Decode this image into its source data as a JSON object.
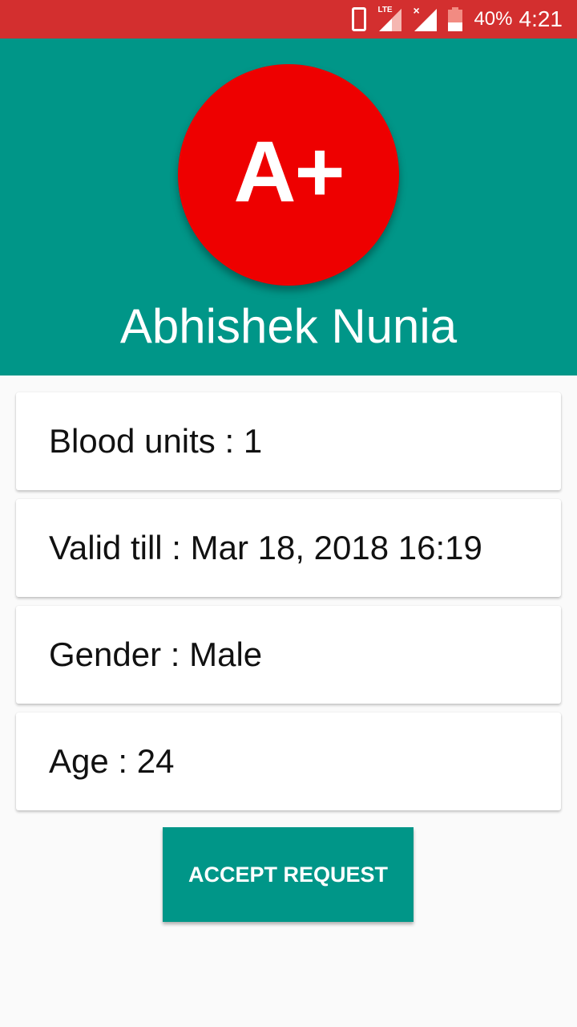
{
  "status_bar": {
    "battery_percent": "40%",
    "time": "4:21",
    "network_label": "LTE",
    "icons": [
      "phone-icon",
      "signal-lte-icon",
      "signal-no-service-icon",
      "battery-icon"
    ]
  },
  "header": {
    "blood_group": "A+",
    "donor_name": "Abhishek Nunia",
    "background_color": "#009688",
    "badge_color": "#ee0000"
  },
  "details": {
    "units": "Blood units : 1",
    "valid_till": "Valid till : Mar 18, 2018 16:19",
    "gender": "Gender : Male",
    "age": "Age : 24"
  },
  "actions": {
    "accept_label": "ACCEPT REQUEST",
    "accent_color": "#009688"
  }
}
